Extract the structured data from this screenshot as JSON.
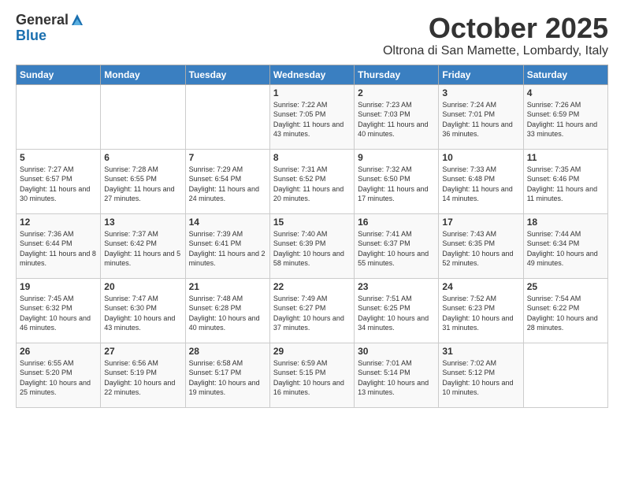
{
  "logo": {
    "general": "General",
    "blue": "Blue"
  },
  "header": {
    "month": "October 2025",
    "location": "Oltrona di San Mamette, Lombardy, Italy"
  },
  "days_of_week": [
    "Sunday",
    "Monday",
    "Tuesday",
    "Wednesday",
    "Thursday",
    "Friday",
    "Saturday"
  ],
  "weeks": [
    [
      {
        "day": "",
        "info": ""
      },
      {
        "day": "",
        "info": ""
      },
      {
        "day": "",
        "info": ""
      },
      {
        "day": "1",
        "info": "Sunrise: 7:22 AM\nSunset: 7:05 PM\nDaylight: 11 hours and 43 minutes."
      },
      {
        "day": "2",
        "info": "Sunrise: 7:23 AM\nSunset: 7:03 PM\nDaylight: 11 hours and 40 minutes."
      },
      {
        "day": "3",
        "info": "Sunrise: 7:24 AM\nSunset: 7:01 PM\nDaylight: 11 hours and 36 minutes."
      },
      {
        "day": "4",
        "info": "Sunrise: 7:26 AM\nSunset: 6:59 PM\nDaylight: 11 hours and 33 minutes."
      }
    ],
    [
      {
        "day": "5",
        "info": "Sunrise: 7:27 AM\nSunset: 6:57 PM\nDaylight: 11 hours and 30 minutes."
      },
      {
        "day": "6",
        "info": "Sunrise: 7:28 AM\nSunset: 6:55 PM\nDaylight: 11 hours and 27 minutes."
      },
      {
        "day": "7",
        "info": "Sunrise: 7:29 AM\nSunset: 6:54 PM\nDaylight: 11 hours and 24 minutes."
      },
      {
        "day": "8",
        "info": "Sunrise: 7:31 AM\nSunset: 6:52 PM\nDaylight: 11 hours and 20 minutes."
      },
      {
        "day": "9",
        "info": "Sunrise: 7:32 AM\nSunset: 6:50 PM\nDaylight: 11 hours and 17 minutes."
      },
      {
        "day": "10",
        "info": "Sunrise: 7:33 AM\nSunset: 6:48 PM\nDaylight: 11 hours and 14 minutes."
      },
      {
        "day": "11",
        "info": "Sunrise: 7:35 AM\nSunset: 6:46 PM\nDaylight: 11 hours and 11 minutes."
      }
    ],
    [
      {
        "day": "12",
        "info": "Sunrise: 7:36 AM\nSunset: 6:44 PM\nDaylight: 11 hours and 8 minutes."
      },
      {
        "day": "13",
        "info": "Sunrise: 7:37 AM\nSunset: 6:42 PM\nDaylight: 11 hours and 5 minutes."
      },
      {
        "day": "14",
        "info": "Sunrise: 7:39 AM\nSunset: 6:41 PM\nDaylight: 11 hours and 2 minutes."
      },
      {
        "day": "15",
        "info": "Sunrise: 7:40 AM\nSunset: 6:39 PM\nDaylight: 10 hours and 58 minutes."
      },
      {
        "day": "16",
        "info": "Sunrise: 7:41 AM\nSunset: 6:37 PM\nDaylight: 10 hours and 55 minutes."
      },
      {
        "day": "17",
        "info": "Sunrise: 7:43 AM\nSunset: 6:35 PM\nDaylight: 10 hours and 52 minutes."
      },
      {
        "day": "18",
        "info": "Sunrise: 7:44 AM\nSunset: 6:34 PM\nDaylight: 10 hours and 49 minutes."
      }
    ],
    [
      {
        "day": "19",
        "info": "Sunrise: 7:45 AM\nSunset: 6:32 PM\nDaylight: 10 hours and 46 minutes."
      },
      {
        "day": "20",
        "info": "Sunrise: 7:47 AM\nSunset: 6:30 PM\nDaylight: 10 hours and 43 minutes."
      },
      {
        "day": "21",
        "info": "Sunrise: 7:48 AM\nSunset: 6:28 PM\nDaylight: 10 hours and 40 minutes."
      },
      {
        "day": "22",
        "info": "Sunrise: 7:49 AM\nSunset: 6:27 PM\nDaylight: 10 hours and 37 minutes."
      },
      {
        "day": "23",
        "info": "Sunrise: 7:51 AM\nSunset: 6:25 PM\nDaylight: 10 hours and 34 minutes."
      },
      {
        "day": "24",
        "info": "Sunrise: 7:52 AM\nSunset: 6:23 PM\nDaylight: 10 hours and 31 minutes."
      },
      {
        "day": "25",
        "info": "Sunrise: 7:54 AM\nSunset: 6:22 PM\nDaylight: 10 hours and 28 minutes."
      }
    ],
    [
      {
        "day": "26",
        "info": "Sunrise: 6:55 AM\nSunset: 5:20 PM\nDaylight: 10 hours and 25 minutes."
      },
      {
        "day": "27",
        "info": "Sunrise: 6:56 AM\nSunset: 5:19 PM\nDaylight: 10 hours and 22 minutes."
      },
      {
        "day": "28",
        "info": "Sunrise: 6:58 AM\nSunset: 5:17 PM\nDaylight: 10 hours and 19 minutes."
      },
      {
        "day": "29",
        "info": "Sunrise: 6:59 AM\nSunset: 5:15 PM\nDaylight: 10 hours and 16 minutes."
      },
      {
        "day": "30",
        "info": "Sunrise: 7:01 AM\nSunset: 5:14 PM\nDaylight: 10 hours and 13 minutes."
      },
      {
        "day": "31",
        "info": "Sunrise: 7:02 AM\nSunset: 5:12 PM\nDaylight: 10 hours and 10 minutes."
      },
      {
        "day": "",
        "info": ""
      }
    ]
  ]
}
